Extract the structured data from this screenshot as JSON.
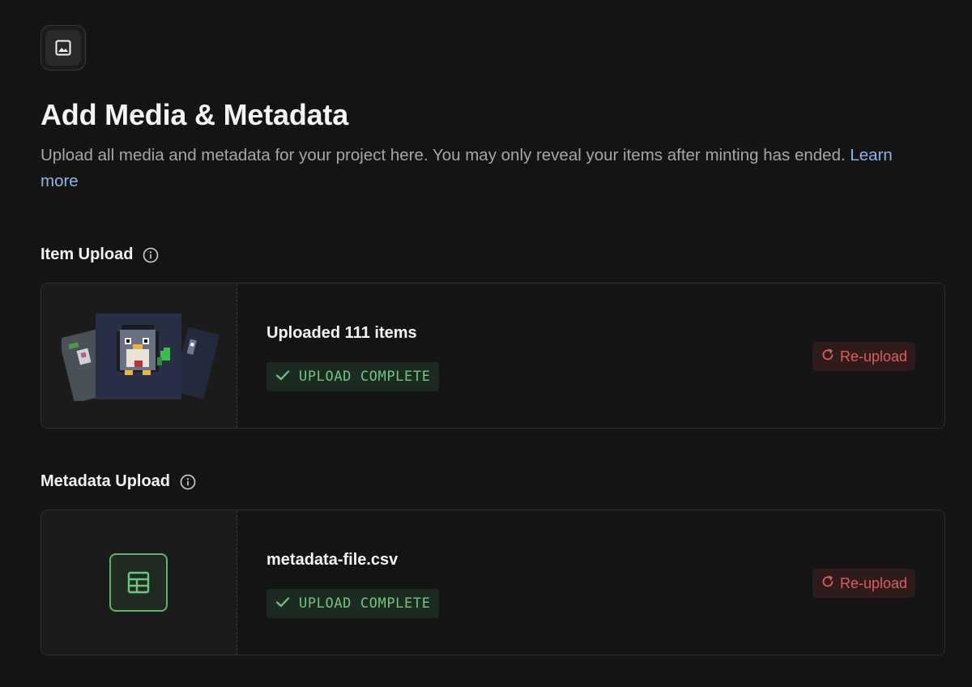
{
  "header": {
    "icon": "image-icon",
    "title": "Add Media & Metadata",
    "description": "Upload all media and metadata for your project here. You may only reveal your items after minting has ended.",
    "learn_more": "Learn more"
  },
  "item_upload": {
    "label": "Item Upload",
    "info_icon": "info-icon",
    "preview": "pixel-penguin-collection",
    "title": "Uploaded 111 items",
    "status": "UPLOAD COMPLETE",
    "reupload_label": "Re-upload"
  },
  "metadata_upload": {
    "label": "Metadata Upload",
    "info_icon": "info-icon",
    "preview_icon": "table-icon",
    "title": "metadata-file.csv",
    "status": "UPLOAD COMPLETE",
    "reupload_label": "Re-upload"
  },
  "colors": {
    "background": "#141415",
    "accent_link": "#8fb3ef",
    "success": "#6dc77d",
    "danger": "#e25c5c"
  }
}
